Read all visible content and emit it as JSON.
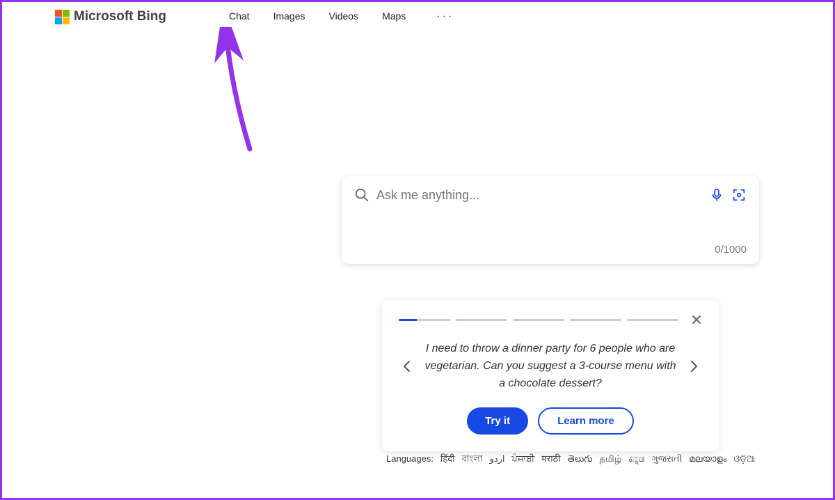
{
  "brand": "Microsoft Bing",
  "nav": {
    "items": [
      "Chat",
      "Images",
      "Videos",
      "Maps"
    ]
  },
  "search": {
    "placeholder": "Ask me anything...",
    "counter": "0/1000"
  },
  "tips": {
    "text": "I need to throw a dinner party for 6 people who are vegetarian. Can you suggest a 3-course menu with a chocolate dessert?",
    "try_label": "Try it",
    "learn_label": "Learn more"
  },
  "languages": {
    "label": "Languages:",
    "items": [
      "हिंदी",
      "বাংলা",
      "اردو",
      "ਪੰਜਾਬੀ",
      "मराठी",
      "తెలుగు",
      "தமிழ்",
      "ಕನ್ನಡ",
      "ગુજરાતી",
      "മലയാളം",
      "ଓଡ଼ିଆ"
    ]
  },
  "colors": {
    "accent": "#174ae4",
    "annotation": "#9333ea"
  }
}
